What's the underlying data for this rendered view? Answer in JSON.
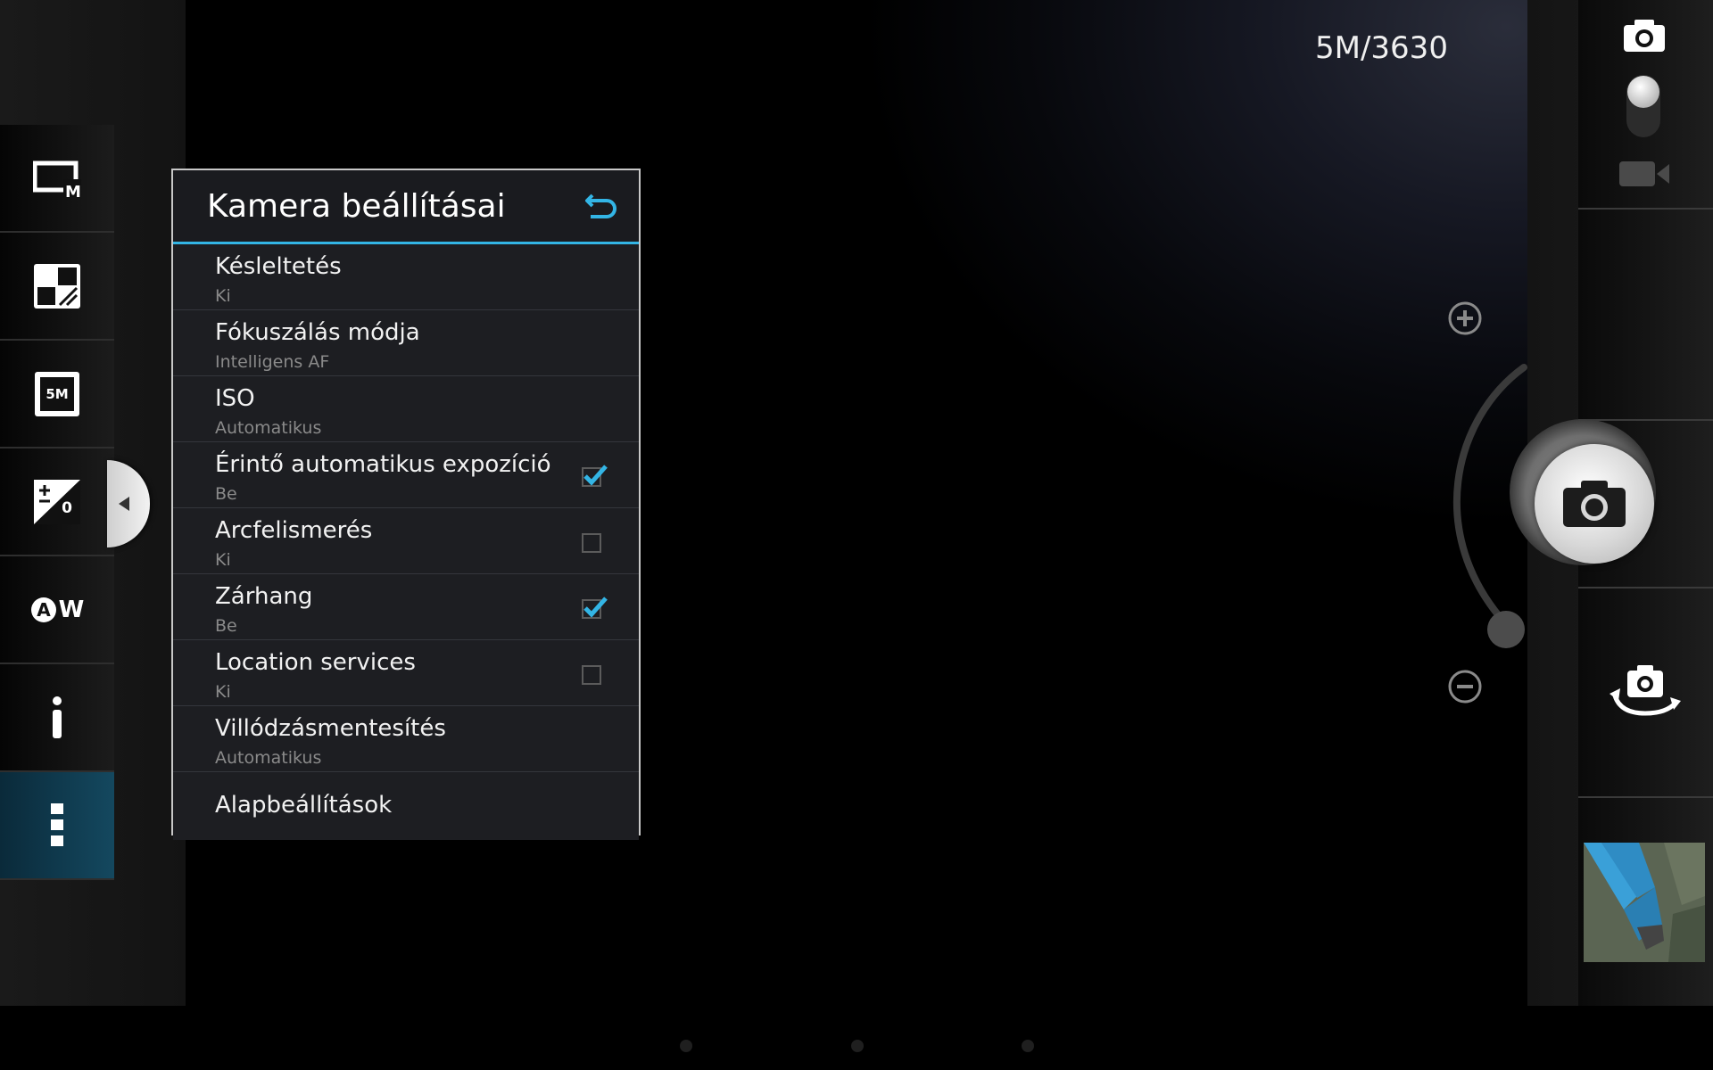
{
  "screen": {
    "resolution_label": "5M/3630"
  },
  "left_panel": {
    "items": [
      {
        "name": "shooting-mode",
        "icon": "screen-m-icon"
      },
      {
        "name": "scene-mode",
        "icon": "scene-icon"
      },
      {
        "name": "picture-size",
        "icon": "5m-size-icon",
        "text": "5M"
      },
      {
        "name": "exposure",
        "icon": "exposure-icon",
        "text": "0"
      },
      {
        "name": "white-balance",
        "icon": "awb-icon",
        "text": "W"
      },
      {
        "name": "info",
        "icon": "info-icon"
      },
      {
        "name": "more-settings",
        "icon": "more-vert-icon",
        "active": true
      }
    ]
  },
  "settings_dialog": {
    "title": "Kamera beállításai",
    "rows": [
      {
        "label": "Késleltetés",
        "value": "Ki"
      },
      {
        "label": "Fókuszálás módja",
        "value": "Intelligens AF"
      },
      {
        "label": "ISO",
        "value": "Automatikus"
      },
      {
        "label": "Érintő automatikus expozíció",
        "value": "Be",
        "checked": true
      },
      {
        "label": "Arcfelismerés",
        "value": "Ki",
        "checked": false
      },
      {
        "label": "Zárhang",
        "value": "Be",
        "checked": true
      },
      {
        "label": "Location services",
        "value": "Ki",
        "checked": false
      },
      {
        "label": "Villódzásmentesítés",
        "value": "Automatikus"
      }
    ],
    "reset_label": "Alapbeállítások"
  },
  "colors": {
    "accent": "#33b5e5",
    "dialog_bg": "#1c1d21",
    "active_panel": "#14485f"
  }
}
